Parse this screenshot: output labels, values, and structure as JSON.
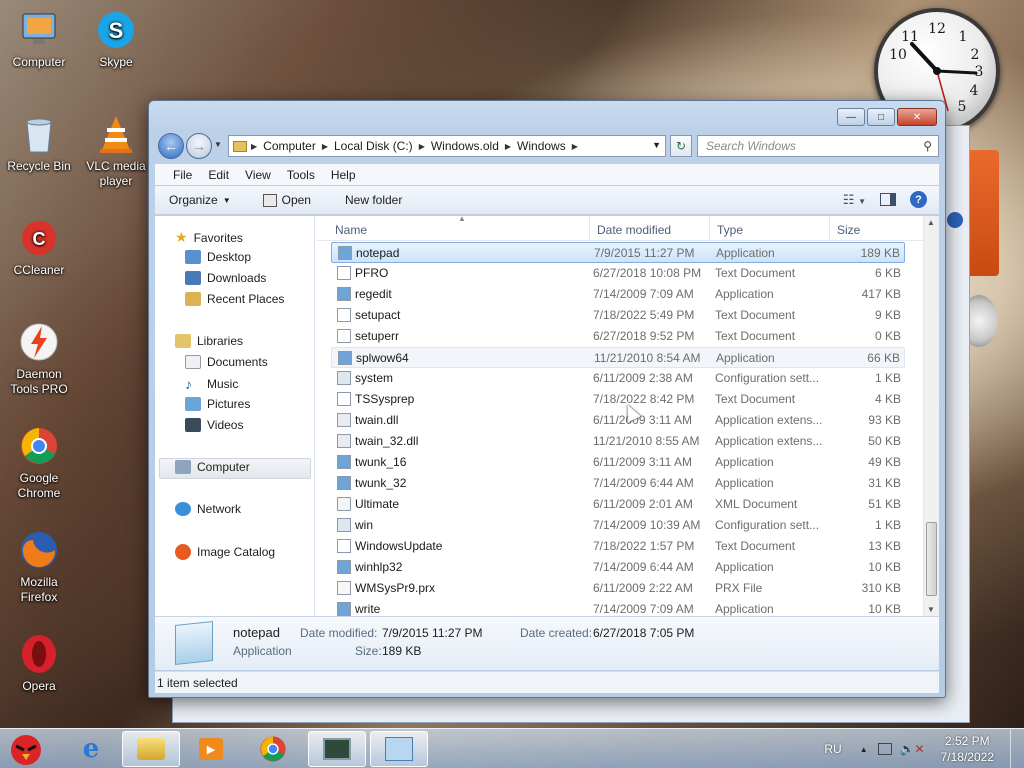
{
  "desktop": {
    "icons": [
      {
        "label": "Computer"
      },
      {
        "label": "Skype"
      },
      {
        "label": "Recycle Bin"
      },
      {
        "label": "VLC media player"
      },
      {
        "label": "CCleaner"
      },
      {
        "label": "Daemon Tools PRO"
      },
      {
        "label": "Google Chrome"
      },
      {
        "label": "Mozilla Firefox"
      },
      {
        "label": "Opera"
      }
    ]
  },
  "window": {
    "breadcrumb": [
      "Computer",
      "Local Disk (C:)",
      "Windows.old",
      "Windows"
    ],
    "search_placeholder": "Search Windows",
    "menu": [
      "File",
      "Edit",
      "View",
      "Tools",
      "Help"
    ],
    "toolbar": {
      "organize": "Organize",
      "open": "Open",
      "new_folder": "New folder"
    },
    "nav": {
      "favorites": "Favorites",
      "desktop": "Desktop",
      "downloads": "Downloads",
      "recent": "Recent Places",
      "libraries": "Libraries",
      "documents": "Documents",
      "music": "Music",
      "pictures": "Pictures",
      "videos": "Videos",
      "computer": "Computer",
      "network": "Network",
      "image_catalog": "Image Catalog"
    },
    "columns": {
      "name": "Name",
      "date": "Date modified",
      "type": "Type",
      "size": "Size"
    },
    "files": [
      {
        "name": "notepad",
        "date": "7/9/2015 11:27 PM",
        "type": "Application",
        "size": "189 KB"
      },
      {
        "name": "PFRO",
        "date": "6/27/2018 10:08 PM",
        "type": "Text Document",
        "size": "6 KB"
      },
      {
        "name": "regedit",
        "date": "7/14/2009 7:09 AM",
        "type": "Application",
        "size": "417 KB"
      },
      {
        "name": "setupact",
        "date": "7/18/2022 5:49 PM",
        "type": "Text Document",
        "size": "9 KB"
      },
      {
        "name": "setuperr",
        "date": "6/27/2018 9:52 PM",
        "type": "Text Document",
        "size": "0 KB"
      },
      {
        "name": "splwow64",
        "date": "11/21/2010 8:54 AM",
        "type": "Application",
        "size": "66 KB"
      },
      {
        "name": "system",
        "date": "6/11/2009 2:38 AM",
        "type": "Configuration sett...",
        "size": "1 KB"
      },
      {
        "name": "TSSysprep",
        "date": "7/18/2022 8:42 PM",
        "type": "Text Document",
        "size": "4 KB"
      },
      {
        "name": "twain.dll",
        "date": "6/11/2009 3:11 AM",
        "type": "Application extens...",
        "size": "93 KB"
      },
      {
        "name": "twain_32.dll",
        "date": "11/21/2010 8:55 AM",
        "type": "Application extens...",
        "size": "50 KB"
      },
      {
        "name": "twunk_16",
        "date": "6/11/2009 3:11 AM",
        "type": "Application",
        "size": "49 KB"
      },
      {
        "name": "twunk_32",
        "date": "7/14/2009 6:44 AM",
        "type": "Application",
        "size": "31 KB"
      },
      {
        "name": "Ultimate",
        "date": "6/11/2009 2:01 AM",
        "type": "XML Document",
        "size": "51 KB"
      },
      {
        "name": "win",
        "date": "7/14/2009 10:39 AM",
        "type": "Configuration sett...",
        "size": "1 KB"
      },
      {
        "name": "WindowsUpdate",
        "date": "7/18/2022 1:57 PM",
        "type": "Text Document",
        "size": "13 KB"
      },
      {
        "name": "winhlp32",
        "date": "7/14/2009 6:44 AM",
        "type": "Application",
        "size": "10 KB"
      },
      {
        "name": "WMSysPr9.prx",
        "date": "6/11/2009 2:22 AM",
        "type": "PRX File",
        "size": "310 KB"
      },
      {
        "name": "write",
        "date": "7/14/2009 7:09 AM",
        "type": "Application",
        "size": "10 KB"
      }
    ],
    "details": {
      "name": "notepad",
      "kind": "Application",
      "date_modified_label": "Date modified:",
      "date_modified": "7/9/2015 11:27 PM",
      "date_created_label": "Date created:",
      "date_created": "6/27/2018 7:05 PM",
      "size_label": "Size:",
      "size": "189 KB"
    },
    "status": "1 item selected"
  },
  "taskbar": {
    "language": "RU",
    "time": "2:52 PM",
    "date": "7/18/2022"
  }
}
